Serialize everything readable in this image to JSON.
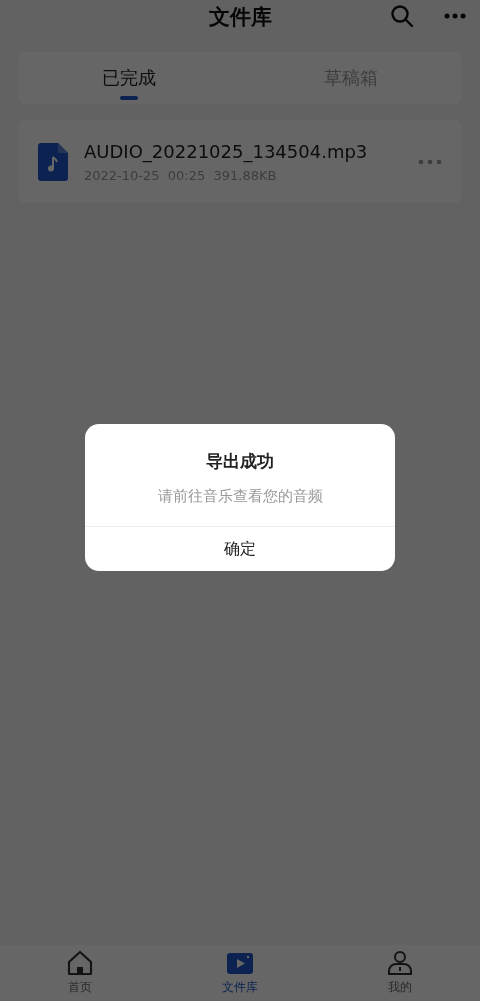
{
  "header": {
    "title": "文件库"
  },
  "tabs": [
    {
      "label": "已完成",
      "selected": true
    },
    {
      "label": "草稿箱",
      "selected": false
    }
  ],
  "files": [
    {
      "name": "AUDIO_20221025_134504.mp3",
      "date": "2022-10-25",
      "duration": "00:25",
      "size": "391.88KB"
    }
  ],
  "dialog": {
    "title": "导出成功",
    "message": "请前往音乐查看您的音频",
    "button": "确定"
  },
  "bottom_nav": [
    {
      "kind": "home",
      "label": "首页",
      "selected": false
    },
    {
      "kind": "library",
      "label": "文件库",
      "selected": true
    },
    {
      "kind": "profile",
      "label": "我的",
      "selected": false
    }
  ]
}
